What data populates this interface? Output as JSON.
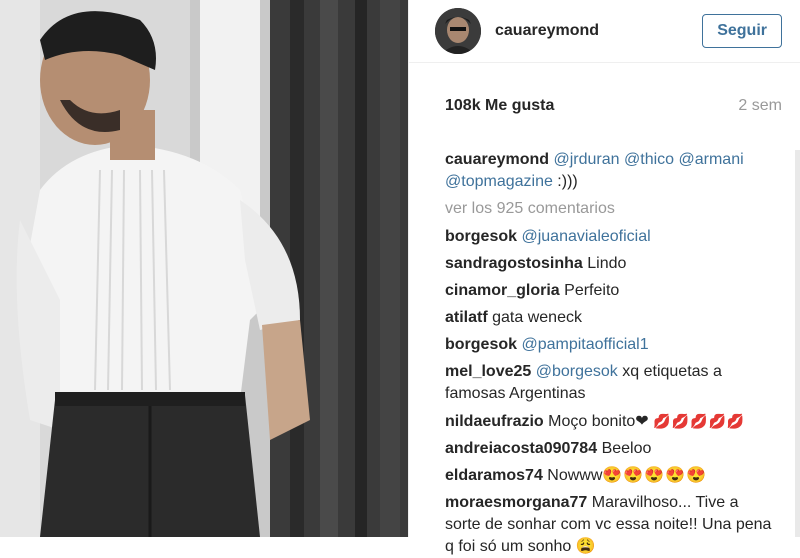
{
  "header": {
    "username": "cauareymond",
    "follow_label": "Seguir"
  },
  "meta": {
    "likes": "108k Me gusta",
    "age": "2 sem"
  },
  "caption": {
    "user": "cauareymond",
    "m1": "@jrduran",
    "m2": "@thico",
    "m3": "@armani",
    "m4": "@topmagazine",
    "tail": " :)))"
  },
  "view_comments": "ver los 925 comentarios",
  "comments": [
    {
      "user": "borgesok",
      "mention": "@juanavialeoficial"
    },
    {
      "user": "sandragostosinha",
      "text": "Lindo"
    },
    {
      "user": "cinamor_gloria",
      "text": "Perfeito"
    },
    {
      "user": "atilatf",
      "text": "gata weneck"
    },
    {
      "user": "borgesok",
      "mention": "@pampitaofficial1"
    },
    {
      "user": "mel_love25",
      "mention": "@borgesok",
      "text": "xq etiquetas a famosas Argentinas"
    },
    {
      "user": "nildaeufrazio",
      "text": "Moço bonito❤",
      "emoji": "💋💋💋💋💋"
    },
    {
      "user": "andreiacosta090784",
      "text": "Beeloo"
    },
    {
      "user": "eldaramos74",
      "text": "Nowww",
      "emoji": "😍😍😍😍😍"
    },
    {
      "user": "moraesmorgana77",
      "text": "Maravilhoso... Tive a sorte de sonhar com vc essa noite!! Una pena q foi só um sonho",
      "emoji": "😩"
    }
  ]
}
